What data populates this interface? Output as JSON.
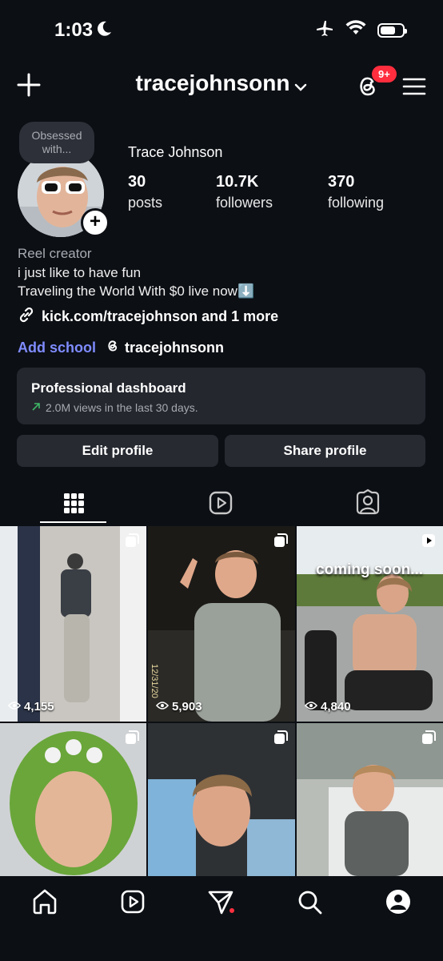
{
  "status_bar": {
    "time": "1:03"
  },
  "header": {
    "username": "tracejohnsonn",
    "notification_count": "9+"
  },
  "profile": {
    "note": "Obsessed with...",
    "display_name": "Trace Johnson",
    "stats": [
      {
        "value": "30",
        "label": "posts"
      },
      {
        "value": "10.7K",
        "label": "followers"
      },
      {
        "value": "370",
        "label": "following"
      }
    ],
    "category": "Reel creator",
    "bio_lines": [
      "i just like to have fun",
      "Traveling the World With $0 live now⬇️"
    ],
    "link": "kick.com/tracejohnson and 1 more",
    "add_school": "Add school",
    "threads_handle": "tracejohnsonn"
  },
  "dashboard": {
    "title": "Professional dashboard",
    "subtitle": "2.0M views in the last 30 days."
  },
  "actions": {
    "edit": "Edit profile",
    "share": "Share profile"
  },
  "tabs": [
    {
      "icon": "grid-icon",
      "active": true
    },
    {
      "icon": "reels-icon",
      "active": false
    },
    {
      "icon": "tagged-icon",
      "active": false
    }
  ],
  "grid": [
    {
      "views": "4,155",
      "type": "carousel",
      "bg": "#d8dadc"
    },
    {
      "views": "5,903",
      "type": "carousel",
      "bg": "#3c3a33",
      "overlay_date": "12/31/20"
    },
    {
      "views": "4,840",
      "type": "reel",
      "bg": "#8fa173",
      "caption": "coming soon..."
    },
    {
      "views": "",
      "type": "carousel",
      "bg": "#6aa63a"
    },
    {
      "views": "",
      "type": "carousel",
      "bg": "#8fb7d6"
    },
    {
      "views": "",
      "type": "carousel",
      "bg": "#9aa3a8"
    }
  ],
  "colors": {
    "background": "#0c0f14",
    "card": "#24272e",
    "accent_link": "#7f8cff",
    "badge": "#ff2d3d",
    "trend_green": "#3fb867"
  }
}
